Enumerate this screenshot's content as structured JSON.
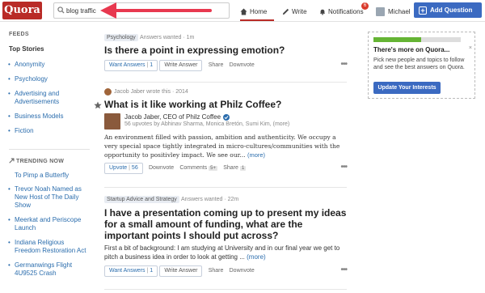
{
  "header": {
    "logo": "Quora",
    "search_value": "blog traffic",
    "nav": {
      "home": "Home",
      "write": "Write",
      "notifications": "Notifications",
      "notifications_count": "6",
      "user": "Michael"
    },
    "add_question": "Add Question",
    "colors": {
      "brand": "#b92b27",
      "accent": "#3b6ac1",
      "annotation_arrow": "#e8384f"
    }
  },
  "sidebar": {
    "feeds_label": "FEEDS",
    "top_stories": "Top Stories",
    "items": [
      "Anonymity",
      "Psychology",
      "Advertising and Advertisements",
      "Business Models",
      "Fiction"
    ],
    "trending_label": "TRENDING NOW",
    "trending": [
      "To Pimp a Butterfly",
      "Trevor Noah Named as New Host of The Daily Show",
      "Meerkat and Periscope Launch",
      "Indiana Religious Freedom Restoration Act",
      "Germanwings Flight 4U9525 Crash"
    ]
  },
  "feed": [
    {
      "topic": "Psychology",
      "meta": "Answers wanted · 1m",
      "title": "Is there a point in expressing emotion?",
      "want_answers": "Want Answers",
      "want_count": "1",
      "write_answer": "Write Answer",
      "share": "Share",
      "downvote": "Downvote"
    },
    {
      "meta": "Jacob Jaber wrote this · 2014",
      "title": "What is it like working at Philz Coffee?",
      "author": "Jacob Jaber, CEO of Philz Coffee",
      "upvoted_by": "56 upvotes by Abhinav Sharma, Monica Bretón, Sumi Kim, (more)",
      "text": "An environment filled with passion, ambition and authenticity. We occupy a very special space tightly integrated in micro-cultures/communities with the opportunity to positivley impact. We see our...",
      "more": "(more)",
      "upvote": "Upvote",
      "upvote_count": "56",
      "downvote": "Downvote",
      "comments": "Comments",
      "comments_count": "5+",
      "share": "Share",
      "share_count": "1"
    },
    {
      "topic": "Startup Advice and Strategy",
      "meta": "Answers wanted · 22m",
      "title": "I have a presentation coming up to present my ideas for a small amount of funding, what are the important points I should put across?",
      "text": "First a bit of background: I am studying at University and in our final year we get to pitch a business idea in order to look at getting ...",
      "more": "(more)",
      "want_answers": "Want Answers",
      "want_count": "1",
      "write_answer": "Write Answer",
      "share": "Share",
      "downvote": "Downvote"
    }
  ],
  "card": {
    "title": "There's more on Quora...",
    "text": "Pick new people and topics to follow and see the best answers on Quora.",
    "button": "Update Your Interests",
    "close": "×",
    "progress": 0.55
  }
}
